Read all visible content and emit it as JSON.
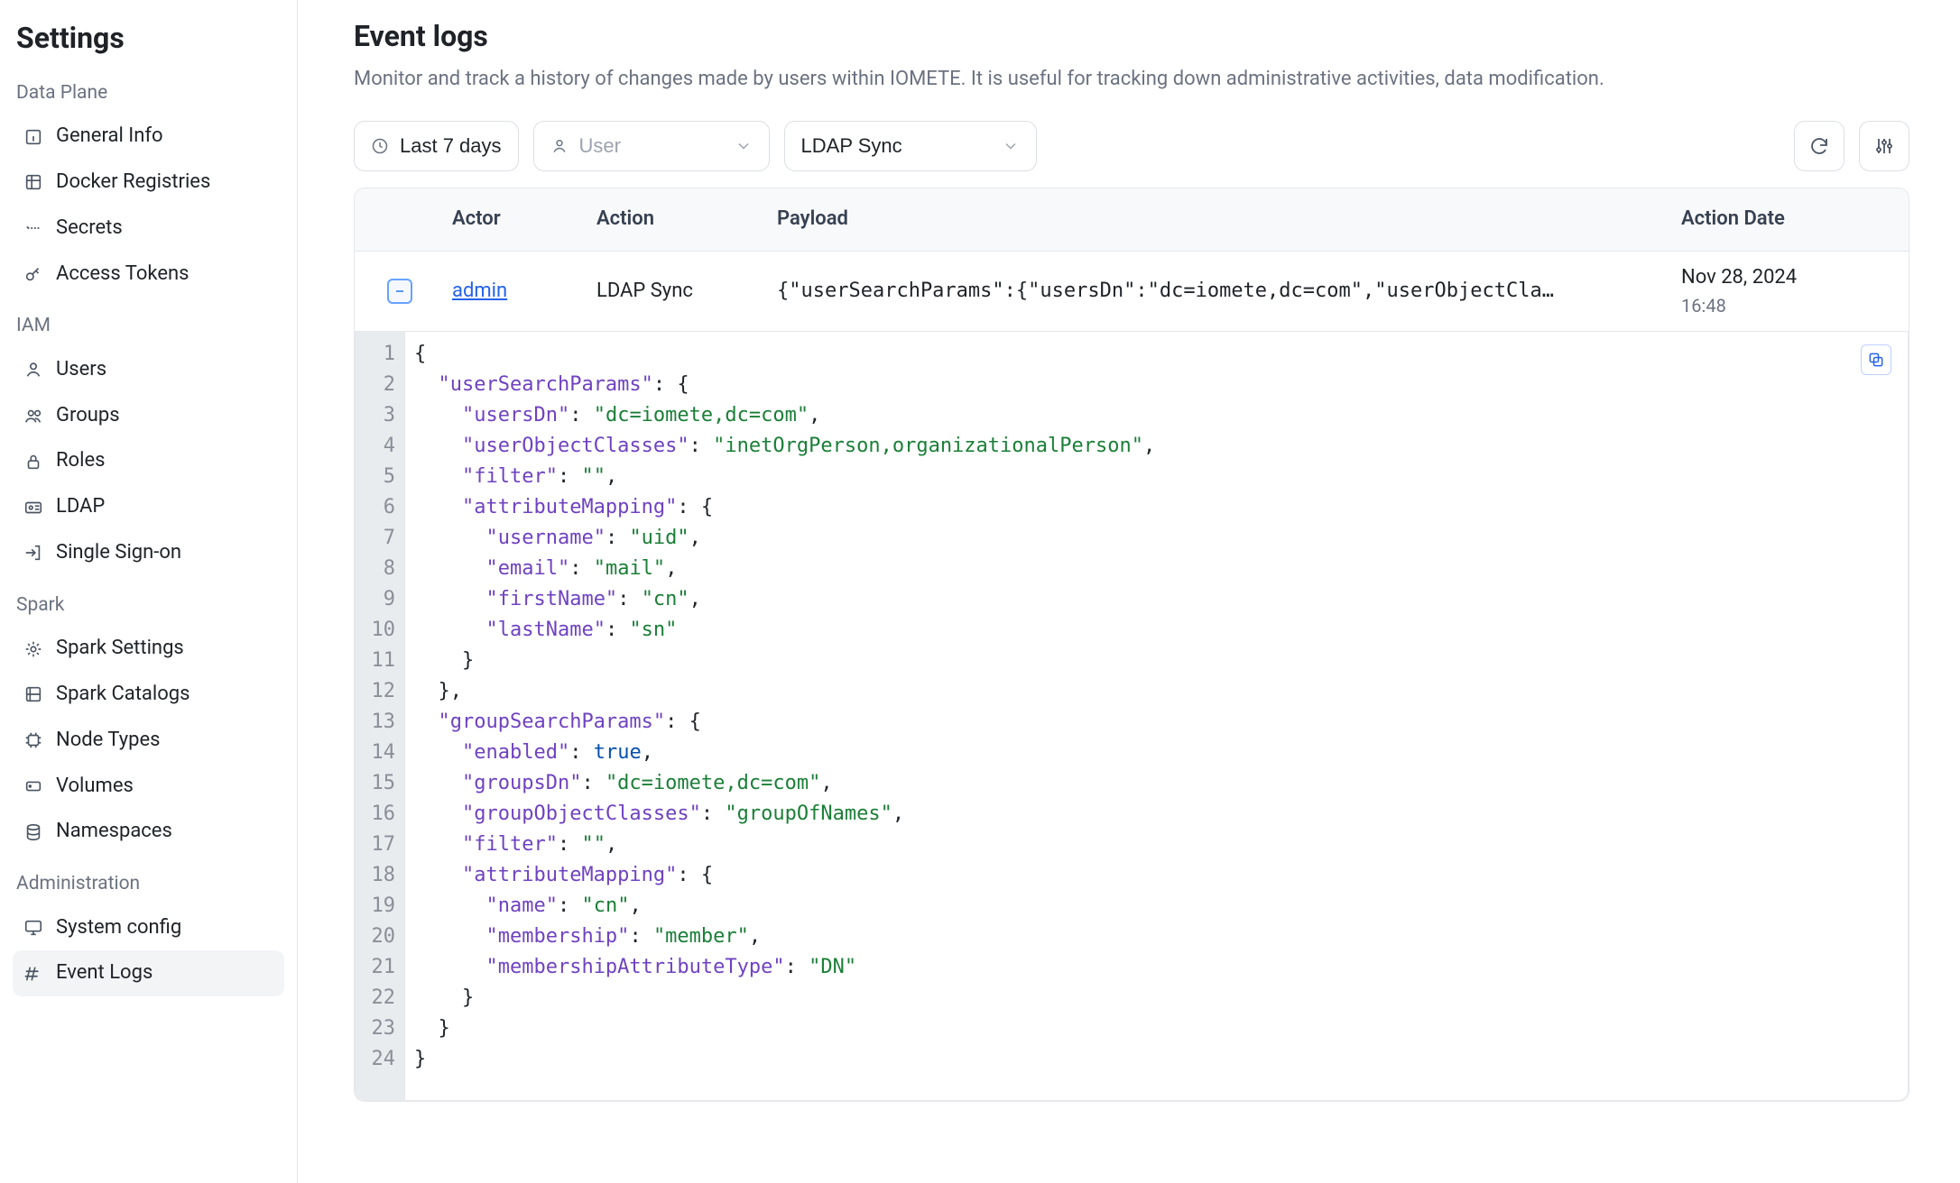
{
  "sidebar": {
    "title": "Settings",
    "groups": [
      {
        "title": "Data Plane",
        "items": [
          {
            "id": "general-info",
            "label": "General Info",
            "icon": "info"
          },
          {
            "id": "docker-registries",
            "label": "Docker Registries",
            "icon": "registry"
          },
          {
            "id": "secrets",
            "label": "Secrets",
            "icon": "secret"
          },
          {
            "id": "access-tokens",
            "label": "Access Tokens",
            "icon": "key"
          }
        ]
      },
      {
        "title": "IAM",
        "items": [
          {
            "id": "users",
            "label": "Users",
            "icon": "user"
          },
          {
            "id": "groups",
            "label": "Groups",
            "icon": "users"
          },
          {
            "id": "roles",
            "label": "Roles",
            "icon": "lock"
          },
          {
            "id": "ldap",
            "label": "LDAP",
            "icon": "id"
          },
          {
            "id": "sso",
            "label": "Single Sign-on",
            "icon": "login"
          }
        ]
      },
      {
        "title": "Spark",
        "items": [
          {
            "id": "spark-settings",
            "label": "Spark Settings",
            "icon": "gear"
          },
          {
            "id": "spark-catalogs",
            "label": "Spark Catalogs",
            "icon": "catalog"
          },
          {
            "id": "node-types",
            "label": "Node Types",
            "icon": "chip"
          },
          {
            "id": "volumes",
            "label": "Volumes",
            "icon": "disk"
          },
          {
            "id": "namespaces",
            "label": "Namespaces",
            "icon": "db"
          }
        ]
      },
      {
        "title": "Administration",
        "items": [
          {
            "id": "system-config",
            "label": "System config",
            "icon": "monitor"
          },
          {
            "id": "event-logs",
            "label": "Event Logs",
            "icon": "log",
            "active": true
          }
        ]
      }
    ]
  },
  "page": {
    "title": "Event logs",
    "description": "Monitor and track a history of changes made by users within IOMETE. It is useful for tracking down administrative activities, data modification."
  },
  "filters": {
    "date_range": "Last 7 days",
    "user_placeholder": "User",
    "action_selected": "LDAP Sync"
  },
  "table": {
    "columns": {
      "actor": "Actor",
      "action": "Action",
      "payload": "Payload",
      "action_date": "Action Date"
    },
    "rows": [
      {
        "actor": "admin",
        "action": "LDAP Sync",
        "payload_preview": "{\"userSearchParams\":{\"usersDn\":\"dc=iomete,dc=com\",\"userObjectCla…",
        "date": "Nov 28, 2024",
        "time": "16:48",
        "expanded": true
      }
    ]
  },
  "code": {
    "lines": [
      {
        "n": 1,
        "t": [
          {
            "c": "p",
            "v": "{"
          }
        ]
      },
      {
        "n": 2,
        "t": [
          {
            "c": "p",
            "v": "  "
          },
          {
            "c": "k",
            "v": "\"userSearchParams\""
          },
          {
            "c": "p",
            "v": ": {"
          }
        ]
      },
      {
        "n": 3,
        "t": [
          {
            "c": "p",
            "v": "    "
          },
          {
            "c": "k",
            "v": "\"usersDn\""
          },
          {
            "c": "p",
            "v": ": "
          },
          {
            "c": "s",
            "v": "\"dc=iomete,dc=com\""
          },
          {
            "c": "p",
            "v": ","
          }
        ]
      },
      {
        "n": 4,
        "t": [
          {
            "c": "p",
            "v": "    "
          },
          {
            "c": "k",
            "v": "\"userObjectClasses\""
          },
          {
            "c": "p",
            "v": ": "
          },
          {
            "c": "s",
            "v": "\"inetOrgPerson,organizationalPerson\""
          },
          {
            "c": "p",
            "v": ","
          }
        ]
      },
      {
        "n": 5,
        "t": [
          {
            "c": "p",
            "v": "    "
          },
          {
            "c": "k",
            "v": "\"filter\""
          },
          {
            "c": "p",
            "v": ": "
          },
          {
            "c": "s",
            "v": "\"\""
          },
          {
            "c": "p",
            "v": ","
          }
        ]
      },
      {
        "n": 6,
        "t": [
          {
            "c": "p",
            "v": "    "
          },
          {
            "c": "k",
            "v": "\"attributeMapping\""
          },
          {
            "c": "p",
            "v": ": {"
          }
        ]
      },
      {
        "n": 7,
        "t": [
          {
            "c": "p",
            "v": "      "
          },
          {
            "c": "k",
            "v": "\"username\""
          },
          {
            "c": "p",
            "v": ": "
          },
          {
            "c": "s",
            "v": "\"uid\""
          },
          {
            "c": "p",
            "v": ","
          }
        ]
      },
      {
        "n": 8,
        "t": [
          {
            "c": "p",
            "v": "      "
          },
          {
            "c": "k",
            "v": "\"email\""
          },
          {
            "c": "p",
            "v": ": "
          },
          {
            "c": "s",
            "v": "\"mail\""
          },
          {
            "c": "p",
            "v": ","
          }
        ]
      },
      {
        "n": 9,
        "t": [
          {
            "c": "p",
            "v": "      "
          },
          {
            "c": "k",
            "v": "\"firstName\""
          },
          {
            "c": "p",
            "v": ": "
          },
          {
            "c": "s",
            "v": "\"cn\""
          },
          {
            "c": "p",
            "v": ","
          }
        ]
      },
      {
        "n": 10,
        "t": [
          {
            "c": "p",
            "v": "      "
          },
          {
            "c": "k",
            "v": "\"lastName\""
          },
          {
            "c": "p",
            "v": ": "
          },
          {
            "c": "s",
            "v": "\"sn\""
          }
        ]
      },
      {
        "n": 11,
        "t": [
          {
            "c": "p",
            "v": "    }"
          }
        ]
      },
      {
        "n": 12,
        "t": [
          {
            "c": "p",
            "v": "  },"
          }
        ]
      },
      {
        "n": 13,
        "t": [
          {
            "c": "p",
            "v": "  "
          },
          {
            "c": "k",
            "v": "\"groupSearchParams\""
          },
          {
            "c": "p",
            "v": ": {"
          }
        ]
      },
      {
        "n": 14,
        "t": [
          {
            "c": "p",
            "v": "    "
          },
          {
            "c": "k",
            "v": "\"enabled\""
          },
          {
            "c": "p",
            "v": ": "
          },
          {
            "c": "b",
            "v": "true"
          },
          {
            "c": "p",
            "v": ","
          }
        ]
      },
      {
        "n": 15,
        "t": [
          {
            "c": "p",
            "v": "    "
          },
          {
            "c": "k",
            "v": "\"groupsDn\""
          },
          {
            "c": "p",
            "v": ": "
          },
          {
            "c": "s",
            "v": "\"dc=iomete,dc=com\""
          },
          {
            "c": "p",
            "v": ","
          }
        ]
      },
      {
        "n": 16,
        "t": [
          {
            "c": "p",
            "v": "    "
          },
          {
            "c": "k",
            "v": "\"groupObjectClasses\""
          },
          {
            "c": "p",
            "v": ": "
          },
          {
            "c": "s",
            "v": "\"groupOfNames\""
          },
          {
            "c": "p",
            "v": ","
          }
        ]
      },
      {
        "n": 17,
        "t": [
          {
            "c": "p",
            "v": "    "
          },
          {
            "c": "k",
            "v": "\"filter\""
          },
          {
            "c": "p",
            "v": ": "
          },
          {
            "c": "s",
            "v": "\"\""
          },
          {
            "c": "p",
            "v": ","
          }
        ]
      },
      {
        "n": 18,
        "t": [
          {
            "c": "p",
            "v": "    "
          },
          {
            "c": "k",
            "v": "\"attributeMapping\""
          },
          {
            "c": "p",
            "v": ": {"
          }
        ]
      },
      {
        "n": 19,
        "t": [
          {
            "c": "p",
            "v": "      "
          },
          {
            "c": "k",
            "v": "\"name\""
          },
          {
            "c": "p",
            "v": ": "
          },
          {
            "c": "s",
            "v": "\"cn\""
          },
          {
            "c": "p",
            "v": ","
          }
        ]
      },
      {
        "n": 20,
        "t": [
          {
            "c": "p",
            "v": "      "
          },
          {
            "c": "k",
            "v": "\"membership\""
          },
          {
            "c": "p",
            "v": ": "
          },
          {
            "c": "s",
            "v": "\"member\""
          },
          {
            "c": "p",
            "v": ","
          }
        ]
      },
      {
        "n": 21,
        "t": [
          {
            "c": "p",
            "v": "      "
          },
          {
            "c": "k",
            "v": "\"membershipAttributeType\""
          },
          {
            "c": "p",
            "v": ": "
          },
          {
            "c": "s",
            "v": "\"DN\""
          }
        ]
      },
      {
        "n": 22,
        "t": [
          {
            "c": "p",
            "v": "    }"
          }
        ]
      },
      {
        "n": 23,
        "t": [
          {
            "c": "p",
            "v": "  }"
          }
        ]
      },
      {
        "n": 24,
        "t": [
          {
            "c": "p",
            "v": "}"
          }
        ]
      }
    ]
  }
}
